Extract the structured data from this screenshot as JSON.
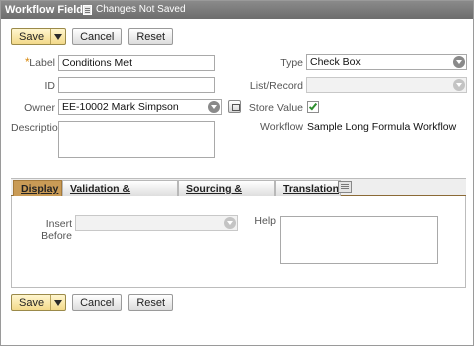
{
  "window": {
    "title": "Workflow Field",
    "status": "Changes Not Saved"
  },
  "buttons": {
    "save": "Save",
    "cancel": "Cancel",
    "reset": "Reset"
  },
  "form": {
    "label": {
      "label": "Label",
      "value": "Conditions Met"
    },
    "id": {
      "label": "ID",
      "value": ""
    },
    "owner": {
      "label": "Owner",
      "value": "EE-10002 Mark Simpson"
    },
    "description": {
      "label": "Description",
      "value": ""
    },
    "type": {
      "label": "Type",
      "value": "Check Box"
    },
    "list_record": {
      "label": "List/Record",
      "value": ""
    },
    "store_value": {
      "label": "Store Value",
      "checked": true
    },
    "workflow": {
      "label": "Workflow",
      "value": "Sample Long Formula Workflow"
    }
  },
  "tabs": [
    {
      "label": "Display",
      "active": true
    },
    {
      "label": "Validation & Defaulting",
      "active": false
    },
    {
      "label": "Sourcing & Filtering",
      "active": false
    },
    {
      "label": "Translation",
      "active": false
    }
  ],
  "display_tab": {
    "insert_before": {
      "label": "Insert Before",
      "value": ""
    },
    "help": {
      "label": "Help",
      "value": ""
    }
  },
  "colors": {
    "accent": "#c99b56",
    "save_button": "#f3d98a",
    "checkmark": "#2f8f2f"
  },
  "icons": {
    "status": "document-icon",
    "dropdown": "dropdown-arrow-icon",
    "popup": "open-popup-icon",
    "tab_options": "list-icon"
  }
}
